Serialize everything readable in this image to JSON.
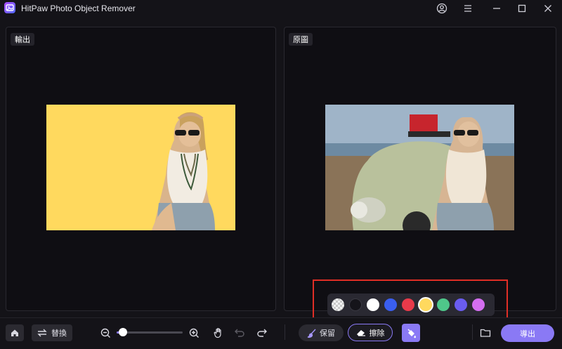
{
  "app": {
    "title": "HitPaw Photo Object Remover"
  },
  "panels": {
    "output": {
      "label": "輸出"
    },
    "original": {
      "label": "原圖"
    }
  },
  "palette": {
    "colors": [
      "transparent",
      "#15141a",
      "#ffffff",
      "#3a5ef0",
      "#e83a4a",
      "#ffd95e",
      "#4fc78a",
      "#6a5cf0",
      "#d46ef0"
    ],
    "selected_index": 5
  },
  "toolbar": {
    "replace_label": "替換",
    "keep_label": "保留",
    "erase_label": "擦除",
    "export_label": "導出",
    "zoom_level": 0.1,
    "accent": "#8a79f5"
  },
  "icons": {
    "home": "home-icon",
    "swap": "swap-icon",
    "zoom_out": "zoom-out-icon",
    "zoom_in": "zoom-in-icon",
    "hand": "hand-icon",
    "undo": "undo-icon",
    "redo": "redo-icon",
    "brush": "brush-icon",
    "eraser": "eraser-icon",
    "bucket": "paint-bucket-icon",
    "folder": "folder-icon",
    "account": "account-icon",
    "menu": "menu-icon",
    "minimize": "minimize-icon",
    "maximize": "maximize-icon",
    "close": "close-icon"
  }
}
